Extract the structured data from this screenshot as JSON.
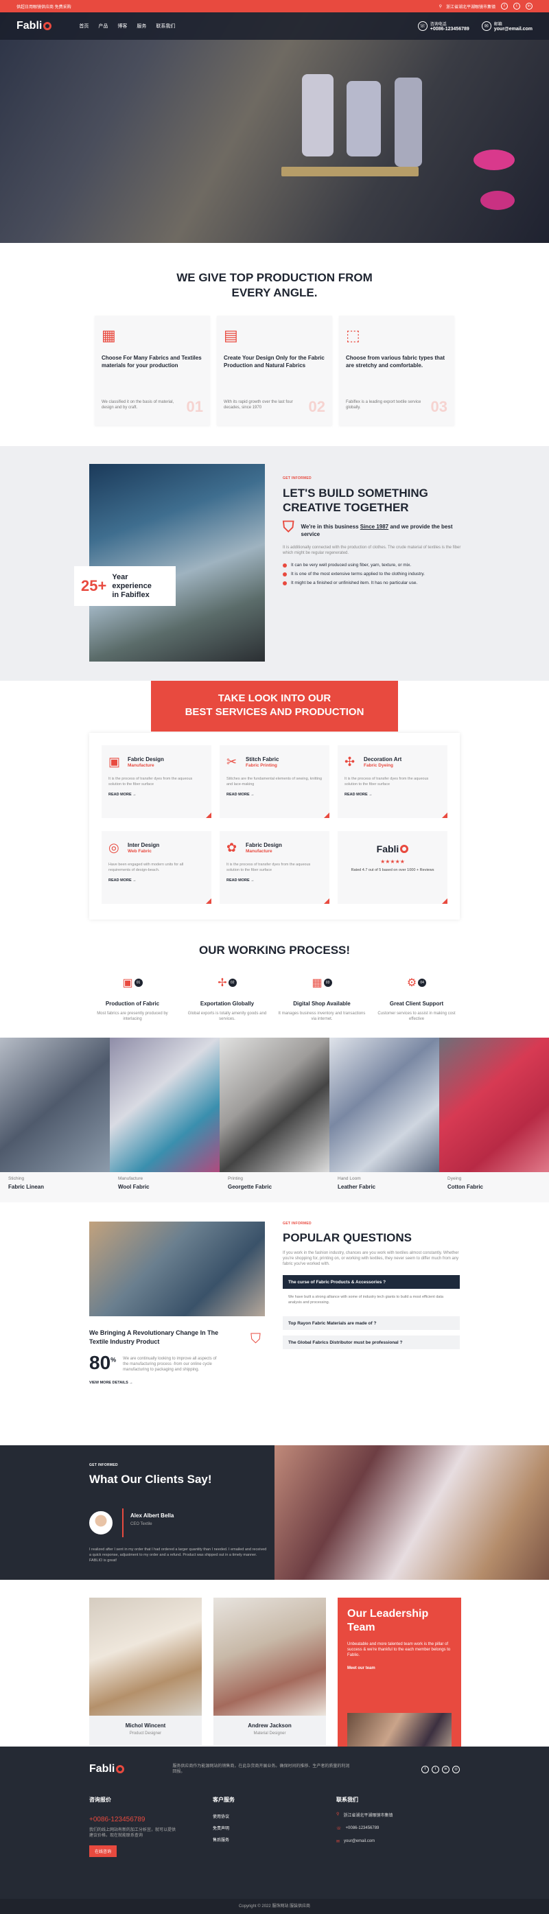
{
  "topbar": {
    "left": "供超日用眼镜供应商 免费采购",
    "address": "浙江省湖北平湖眼镜市集镇"
  },
  "nav": {
    "logo": "Fabli",
    "links": [
      "首页",
      "产品",
      "博客",
      "服务",
      "联系我们"
    ],
    "phone_label": "咨询电话",
    "phone": "+0086-123456789",
    "email_label": "邮箱",
    "email": "your@email.com"
  },
  "hero": {},
  "production": {
    "title_1": "WE GIVE TOP PRODUCTION FROM",
    "title_2": "EVERY ANGLE.",
    "cards": [
      {
        "title": "Choose For Many Fabrics and Textiles materials for your production",
        "desc": "We classified it on the basis of material, design and by craft.",
        "num": "01"
      },
      {
        "title": "Create Your Design Only for the Fabric Production and Natural Fabrics",
        "desc": "With its rapid growth over the last four decades, since 1970",
        "num": "02"
      },
      {
        "title": "Choose from various fabric types that are stretchy and comfortable.",
        "desc": "Fabiflex is a leading export textile service globally.",
        "num": "03"
      }
    ]
  },
  "build": {
    "years_num": "25+",
    "years_text_1": "Year experience",
    "years_text_2": "in Fabiflex",
    "tag": "GET INFORMED",
    "title_1": "LET'S BUILD SOMETHING",
    "title_2": "CREATIVE TOGETHER",
    "quote_1": "We're in this business",
    "quote_since": "Since 1987",
    "quote_2": "and we provide the best service",
    "desc": "It is additionally connected with the production of clothes. The crude material of textiles is the fiber which might be regular regenerated.",
    "bullets": [
      "It can be very well produced using fiber, yarn, texture, or mix.",
      "It is one of the most extensive terms applied to the clothing industry.",
      "It might be a finished or unfinished item. It has no particular use."
    ]
  },
  "services": {
    "title_1": "TAKE LOOK INTO OUR",
    "title_2": "BEST SERVICES AND PRODUCTION",
    "items": [
      {
        "title": "Fabric Design",
        "sub": "Manufacture",
        "desc": "It is the process of transfer dyes from the aqueous solution to the fiber surface",
        "more": "READ MORE →"
      },
      {
        "title": "Stitch Fabric",
        "sub": "Fabric Printing",
        "desc": "Stitches are the fundamental elements of sewing, knitting and lace-making",
        "more": "READ MORE →"
      },
      {
        "title": "Decoration Art",
        "sub": "Fabric Dyeing",
        "desc": "It is the process of transfer dyes from the aqueous solution to the fiber surface",
        "more": "READ MORE →"
      },
      {
        "title": "Inter Design",
        "sub": "Web Fabric",
        "desc": "Have been engaged with modern units for all requirements of design-beach.",
        "more": "READ MORE →"
      },
      {
        "title": "Fabric Design",
        "sub": "Manufacture",
        "desc": "It is the process of transfer dyes from the aqueous solution to the fiber surface",
        "more": "READ MORE →"
      }
    ],
    "rating": {
      "logo": "Fabli",
      "stars": "★★★★★",
      "text": "Rated 4.7 out of 5 based on over 1000 + Reviews"
    }
  },
  "process": {
    "title": "OUR WORKING PROCESS!",
    "steps": [
      {
        "num": "01",
        "title": "Production of Fabric",
        "desc": "Most fabrics are presently produced by interlacing"
      },
      {
        "num": "02",
        "title": "Exportation Globally",
        "desc": "Global exports is totally amenity goods and services."
      },
      {
        "num": "03",
        "title": "Digital Shop Available",
        "desc": "It manages business inventory and transactions via internet."
      },
      {
        "num": "04",
        "title": "Great Client Support",
        "desc": "Customer services to assist in making cost effective"
      }
    ]
  },
  "gallery": [
    {
      "sub": "Stiching",
      "title": "Fabric Linean"
    },
    {
      "sub": "Manufacture",
      "title": "Wool Fabric"
    },
    {
      "sub": "Printing",
      "title": "Georgette Fabric"
    },
    {
      "sub": "Hand Loom",
      "title": "Leather Fabric"
    },
    {
      "sub": "Dyeing",
      "title": "Cotton Fabric"
    }
  ],
  "faq": {
    "left_title": "We Bringing A Revolutionary Change In The Textile Industry Product",
    "stat": "80",
    "stat_unit": "%",
    "stat_desc": "We are continually looking to improve all aspects of the manufacturing process -from our online cycle manufacturing to packaging and shipping.",
    "more": "VIEW MORE DETAILS →",
    "tag": "GET INFORMED",
    "title": "POPULAR QUESTIONS",
    "desc": "If you work in the fashion industry, chances are you work with textiles almost constantly. Whether you're shopping for, printing on, or working with textiles, they never seem to differ much from any fabric you've worked with.",
    "items": [
      {
        "q": "The curse of Fabric Products & Accessories ?",
        "a": "We have built a strong alliance with some of industry tech giants to build a most efficient data analysis and processing."
      },
      {
        "q": "Top Rayon Fabric Materials are made of ?"
      },
      {
        "q": "The Global Fabrics Distributor must be professional ?"
      }
    ]
  },
  "testimonial": {
    "tag": "GET INFORMED",
    "title": "What Our Clients Say!",
    "name": "Alex Albert Bella",
    "role": "CEO Textile",
    "text": "I realized after I sent in my order that I had ordered a larger quantity than I needed. I emailed and received a quick response, adjustment to my order and a refund. Product was shipped out in a timely manner. FABLIO is great!"
  },
  "leaders": {
    "people": [
      {
        "name": "Michol Wincent",
        "role": "Product Designer"
      },
      {
        "name": "Andrew Jackson",
        "role": "Material Designer"
      }
    ],
    "title_1": "Our Leadership",
    "title_2": "Team",
    "desc": "Unbeatable and more talented team work is the pillar of success & we're thankful to the each member belongs to Fablio.",
    "more": "Meet our team"
  },
  "footer": {
    "logo": "Fabli",
    "desc": "服务供应商作为能源网站的销售商，在此杂货商开展业务。确保时间的推移、生产者的质量的利润回报。",
    "col1": {
      "title": "咨询报价",
      "phone": "+0086-123456789",
      "desc": "我们的线上网站有新的加工分析宜，就可以提供建议价格，现在就能联系查询",
      "btn": "在线咨询"
    },
    "col2": {
      "title": "客户服务",
      "links": [
        "使用协议",
        "免责声明",
        "售后服务"
      ]
    },
    "col3": {
      "title": "联系我们",
      "address": "浙江省湖北平湖眼镜市集镇",
      "phone": "+0086-123456789",
      "email": "your@email.com"
    },
    "copyright": "Copyright © 2022 服饰网站 服装供应商"
  }
}
